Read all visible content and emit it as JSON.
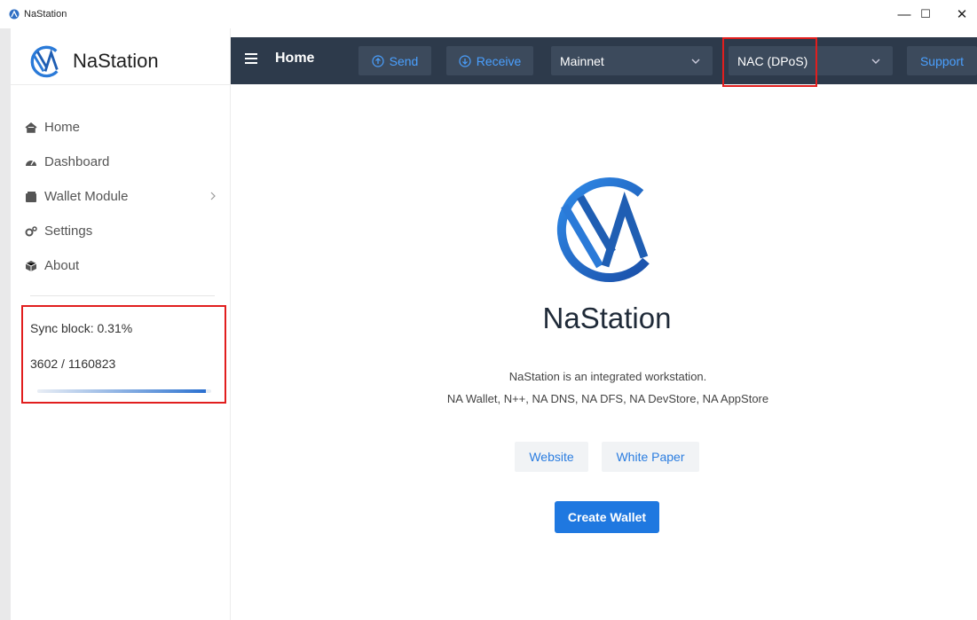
{
  "window": {
    "title": "NaStation",
    "minimize": "—",
    "maximize": "☐",
    "close": "✕"
  },
  "sidebar": {
    "brand": "NaStation",
    "items": [
      {
        "label": "Home",
        "icon": "home-icon"
      },
      {
        "label": "Dashboard",
        "icon": "dashboard-icon"
      },
      {
        "label": "Wallet Module",
        "icon": "wallet-icon",
        "has_submenu": true
      },
      {
        "label": "Settings",
        "icon": "gears-icon"
      },
      {
        "label": "About",
        "icon": "cube-icon"
      }
    ],
    "sync": {
      "title": "Sync block: 0.31%",
      "count": "3602 / 1160823",
      "progress_fraction": 0.97
    }
  },
  "header": {
    "title": "Home",
    "send": "Send",
    "receive": "Receive",
    "network": "Mainnet",
    "chain": "NAC (DPoS)",
    "support": "Support"
  },
  "main": {
    "title": "NaStation",
    "desc1": "NaStation is an integrated workstation.",
    "desc2": "NA Wallet, N++, NA DNS, NA DFS, NA DevStore, NA AppStore",
    "website": "Website",
    "whitepaper": "White Paper",
    "create_wallet": "Create Wallet"
  },
  "colors": {
    "header_bg": "#2d3a4b",
    "accent": "#1f78e0",
    "highlight": "#e11e1e"
  }
}
